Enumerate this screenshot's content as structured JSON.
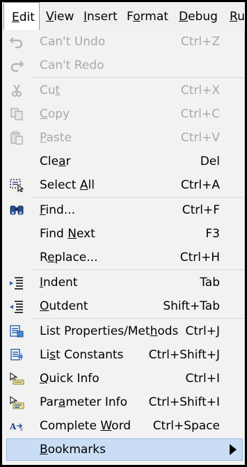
{
  "menubar": {
    "items": [
      {
        "label": "Edit",
        "accel": "E"
      },
      {
        "label": "View",
        "accel": "V"
      },
      {
        "label": "Insert",
        "accel": "I"
      },
      {
        "label": "Format",
        "accel": "o"
      },
      {
        "label": "Debug",
        "accel": "D"
      },
      {
        "label": "Ru",
        "accel": "R"
      }
    ]
  },
  "menu": {
    "undo": {
      "label": "Can't Undo",
      "shortcut": "Ctrl+Z"
    },
    "redo": {
      "label": "Can't Redo",
      "shortcut": ""
    },
    "cut": {
      "pre": "Cu",
      "acc": "t",
      "post": "",
      "shortcut": "Ctrl+X"
    },
    "copy": {
      "pre": "",
      "acc": "C",
      "post": "opy",
      "shortcut": "Ctrl+C"
    },
    "paste": {
      "pre": "",
      "acc": "P",
      "post": "aste",
      "shortcut": "Ctrl+V"
    },
    "clear": {
      "pre": "Cle",
      "acc": "a",
      "post": "r",
      "shortcut": "Del"
    },
    "select_all": {
      "pre": "Select ",
      "acc": "A",
      "post": "ll",
      "shortcut": "Ctrl+A"
    },
    "find": {
      "pre": "",
      "acc": "F",
      "post": "ind...",
      "shortcut": "Ctrl+F"
    },
    "find_next": {
      "pre": "Find ",
      "acc": "N",
      "post": "ext",
      "shortcut": "F3"
    },
    "replace": {
      "pre": "R",
      "acc": "e",
      "post": "place...",
      "shortcut": "Ctrl+H"
    },
    "indent": {
      "pre": "",
      "acc": "I",
      "post": "ndent",
      "shortcut": "Tab"
    },
    "outdent": {
      "pre": "",
      "acc": "O",
      "post": "utdent",
      "shortcut": "Shift+Tab"
    },
    "list_props": {
      "pre": "List Properties/Met",
      "acc": "h",
      "post": "ods",
      "shortcut": "Ctrl+J"
    },
    "list_consts": {
      "pre": "Li",
      "acc": "s",
      "post": "t Constants",
      "shortcut": "Ctrl+Shift+J"
    },
    "quick_info": {
      "pre": "",
      "acc": "Q",
      "post": "uick Info",
      "shortcut": "Ctrl+I"
    },
    "param_info": {
      "pre": "Par",
      "acc": "a",
      "post": "meter Info",
      "shortcut": "Ctrl+Shift+I"
    },
    "complete": {
      "pre": "Complete ",
      "acc": "W",
      "post": "ord",
      "shortcut": "Ctrl+Space"
    },
    "bookmarks": {
      "pre": "",
      "acc": "B",
      "post": "ookmarks",
      "shortcut": ""
    }
  },
  "colors": {
    "highlight": "#c9def5",
    "disabled_text": "#a8a8a8"
  }
}
